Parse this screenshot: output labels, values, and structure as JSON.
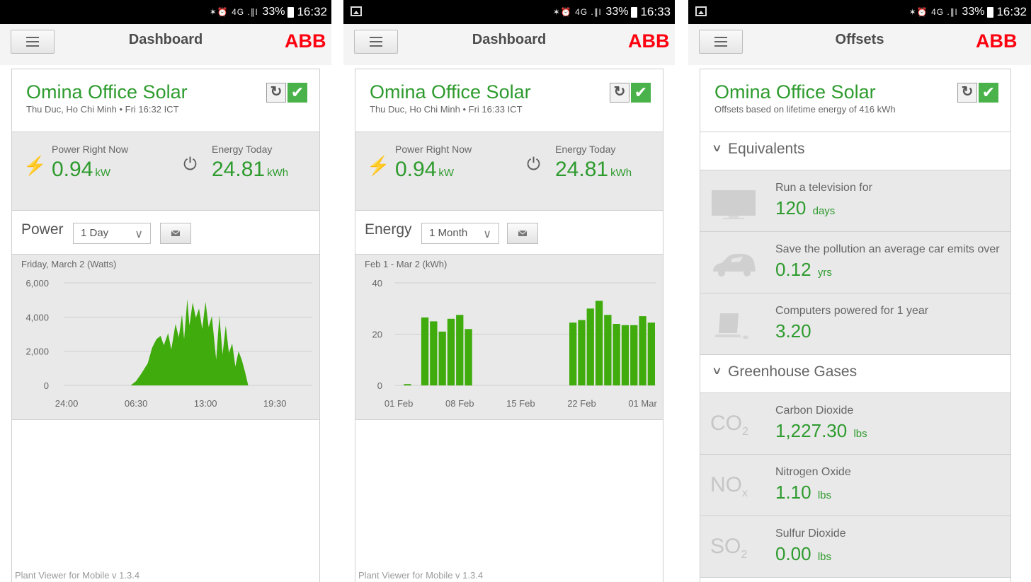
{
  "status_bar": {
    "indicators": "✶⏰ 4G .∥l",
    "battery": "33%",
    "screens": [
      {
        "time": "16:32",
        "gallery_icon": false
      },
      {
        "time": "16:33",
        "gallery_icon": true
      },
      {
        "time": "16:32",
        "gallery_icon": true
      }
    ]
  },
  "brand": {
    "logo_text": "ABB",
    "logo_color": "#ff000f"
  },
  "colors": {
    "accent_green": "#2e9b2e",
    "chart_green": "#3fab0c"
  },
  "screens": [
    {
      "app_title": "Dashboard",
      "plant_name": "Omina Office Solar",
      "plant_sub": "Thu Duc, Ho Chi Minh • Fri 16:32 ICT",
      "power_label": "Power Right Now",
      "power_value": "0.94",
      "power_unit": "kW",
      "energy_label": "Energy Today",
      "energy_value": "24.81",
      "energy_unit": "kWh",
      "chart_kind": "Power",
      "range": "1 Day",
      "chart_title": "Friday, March 2 (Watts)",
      "footer": "Plant Viewer for Mobile v 1.3.4"
    },
    {
      "app_title": "Dashboard",
      "plant_name": "Omina Office Solar",
      "plant_sub": "Thu Duc, Ho Chi Minh • Fri 16:33 ICT",
      "power_label": "Power Right Now",
      "power_value": "0.94",
      "power_unit": "kW",
      "energy_label": "Energy Today",
      "energy_value": "24.81",
      "energy_unit": "kWh",
      "chart_kind": "Energy",
      "range": "1 Month",
      "chart_title": "Feb 1 - Mar 2 (kWh)",
      "footer": "Plant Viewer for Mobile v 1.3.4"
    },
    {
      "app_title": "Offsets",
      "plant_name": "Omina Office Solar",
      "plant_sub": "Offsets based on lifetime energy of 416 kWh",
      "sections": [
        {
          "title": "Equivalents",
          "rows": [
            {
              "icon": "television-icon",
              "label": "Run a television for",
              "value": "120",
              "unit": "days"
            },
            {
              "icon": "car-icon",
              "label": "Save the pollution an average car emits over",
              "value": "0.12",
              "unit": "yrs"
            },
            {
              "icon": "computer-icon",
              "label": "Computers powered for 1 year",
              "value": "3.20",
              "unit": ""
            }
          ]
        },
        {
          "title": "Greenhouse Gases",
          "rows": [
            {
              "chem": "CO",
              "sub": "2",
              "label": "Carbon Dioxide",
              "value": "1,227.30",
              "unit": "lbs"
            },
            {
              "chem": "NO",
              "sub": "x",
              "label": "Nitrogen Oxide",
              "value": "1.10",
              "unit": "lbs"
            },
            {
              "chem": "SO",
              "sub": "2",
              "label": "Sulfur Dioxide",
              "value": "0.00",
              "unit": "lbs"
            }
          ]
        }
      ]
    }
  ],
  "chart_data": [
    {
      "type": "area",
      "title": "Friday, March 2 (Watts)",
      "ylim": [
        0,
        6000
      ],
      "y_ticks": [
        "6,000",
        "4,000",
        "2,000",
        "0"
      ],
      "y_tick_values": [
        6000,
        4000,
        2000,
        0
      ],
      "x_tick_labels": [
        "24:00",
        "06:30",
        "13:00",
        "19:30"
      ],
      "x_tick_hours": [
        0,
        6.5,
        13,
        19.5
      ],
      "x_range_hours": [
        -1,
        23
      ],
      "grid": true,
      "points": [
        [
          6.0,
          0
        ],
        [
          6.5,
          250
        ],
        [
          7.0,
          700
        ],
        [
          7.6,
          1300
        ],
        [
          8.0,
          2200
        ],
        [
          8.4,
          2700
        ],
        [
          8.8,
          2900
        ],
        [
          9.1,
          2350
        ],
        [
          9.5,
          3050
        ],
        [
          9.8,
          2100
        ],
        [
          10.2,
          3600
        ],
        [
          10.5,
          2800
        ],
        [
          10.8,
          4150
        ],
        [
          11.0,
          2700
        ],
        [
          11.3,
          5050
        ],
        [
          11.5,
          3500
        ],
        [
          11.8,
          4850
        ],
        [
          12.1,
          3950
        ],
        [
          12.4,
          4500
        ],
        [
          12.7,
          3300
        ],
        [
          13.0,
          4900
        ],
        [
          13.3,
          3400
        ],
        [
          13.6,
          4050
        ],
        [
          14.0,
          1500
        ],
        [
          14.3,
          4100
        ],
        [
          14.6,
          1800
        ],
        [
          14.9,
          3500
        ],
        [
          15.2,
          1900
        ],
        [
          15.5,
          2450
        ],
        [
          15.8,
          1100
        ],
        [
          16.1,
          2000
        ],
        [
          16.4,
          1500
        ],
        [
          16.7,
          800
        ],
        [
          17.0,
          0
        ]
      ]
    },
    {
      "type": "bar",
      "title": "Feb 1 - Mar 2 (kWh)",
      "ylim": [
        0,
        40
      ],
      "y_ticks": [
        "40",
        "20",
        "0"
      ],
      "y_tick_values": [
        40,
        20,
        0
      ],
      "x_tick_labels": [
        "01 Feb",
        "08 Feb",
        "15 Feb",
        "22 Feb",
        "01 Mar"
      ],
      "x_tick_days": [
        1,
        8,
        15,
        22,
        29
      ],
      "grid": true,
      "days": [
        1,
        2,
        3,
        4,
        5,
        6,
        7,
        8,
        9,
        10,
        11,
        12,
        13,
        14,
        15,
        16,
        17,
        18,
        19,
        20,
        21,
        22,
        23,
        24,
        25,
        26,
        27,
        28,
        29,
        30
      ],
      "values": [
        0,
        0.5,
        0,
        26.5,
        25,
        21,
        26,
        27.5,
        22,
        0,
        0,
        0,
        0,
        0,
        0,
        0,
        0,
        0,
        0,
        0,
        24.5,
        25.5,
        30,
        33,
        27.5,
        24,
        23.5,
        23.5,
        27,
        24.5
      ]
    }
  ]
}
